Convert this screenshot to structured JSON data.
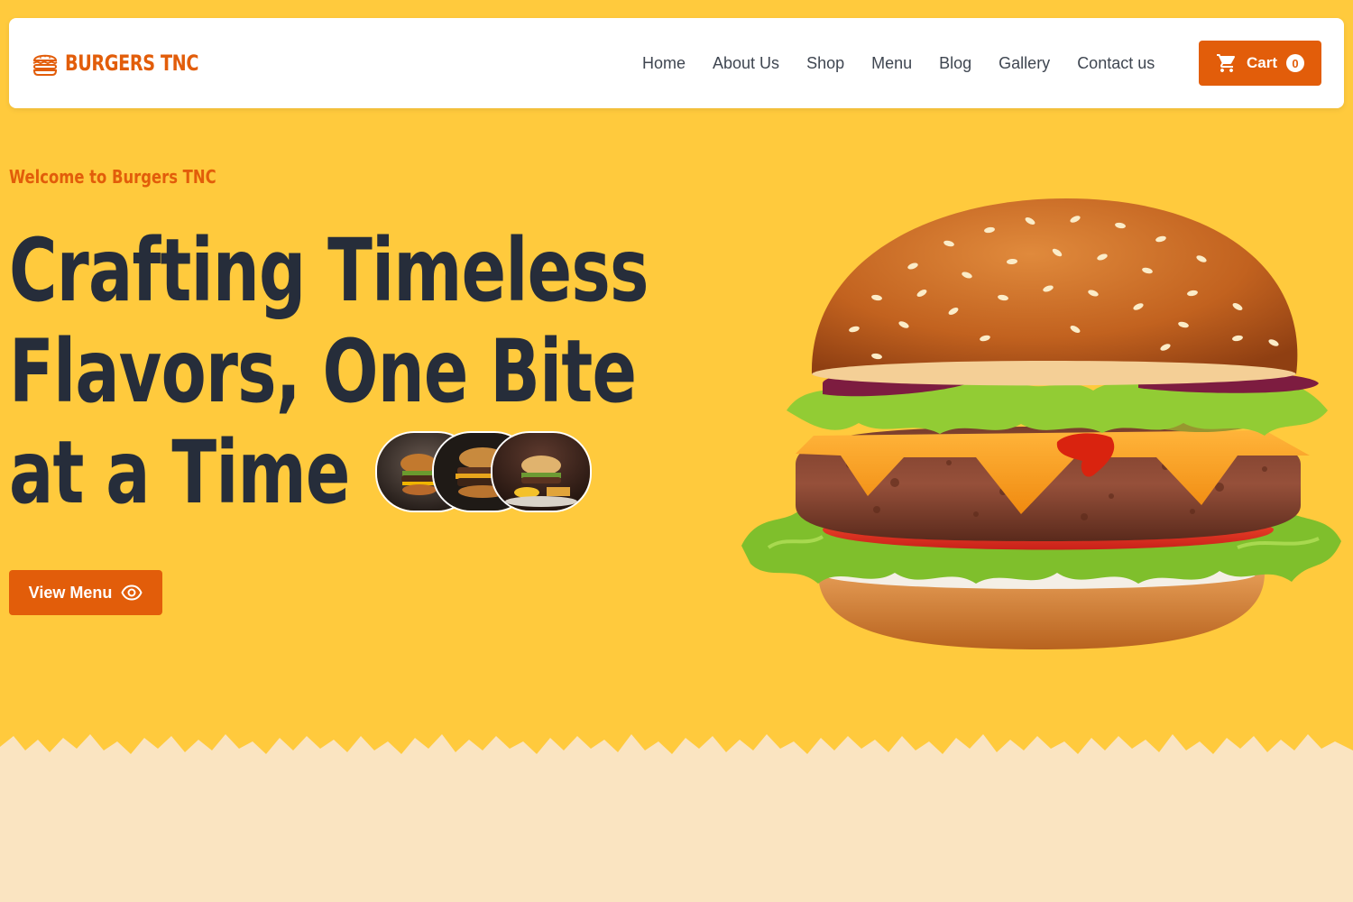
{
  "brand": {
    "name": "BURGERS TNC",
    "icon": "burger-icon"
  },
  "nav": {
    "items": [
      {
        "label": "Home"
      },
      {
        "label": "About Us"
      },
      {
        "label": "Shop"
      },
      {
        "label": "Menu"
      },
      {
        "label": "Blog"
      },
      {
        "label": "Gallery"
      },
      {
        "label": "Contact us"
      }
    ]
  },
  "cart": {
    "label": "Cart",
    "count": "0",
    "icon": "shopping-cart-icon"
  },
  "hero": {
    "eyebrow": "Welcome to Burgers TNC",
    "title_lines": [
      "Crafting Timeless",
      "Flavors, One Bite",
      "at a Time"
    ],
    "cta_label": "View Menu",
    "cta_icon": "eye-icon",
    "thumbnails": [
      "burger-photo",
      "burger-photo",
      "burger-photo"
    ],
    "image": "burger-photo"
  },
  "colors": {
    "background": "#ffca3d",
    "accent": "#e25d0a",
    "heading": "#262d3a",
    "nav_text": "#3f4651",
    "lower_section": "#fae4c1",
    "header_bg": "#ffffff"
  }
}
